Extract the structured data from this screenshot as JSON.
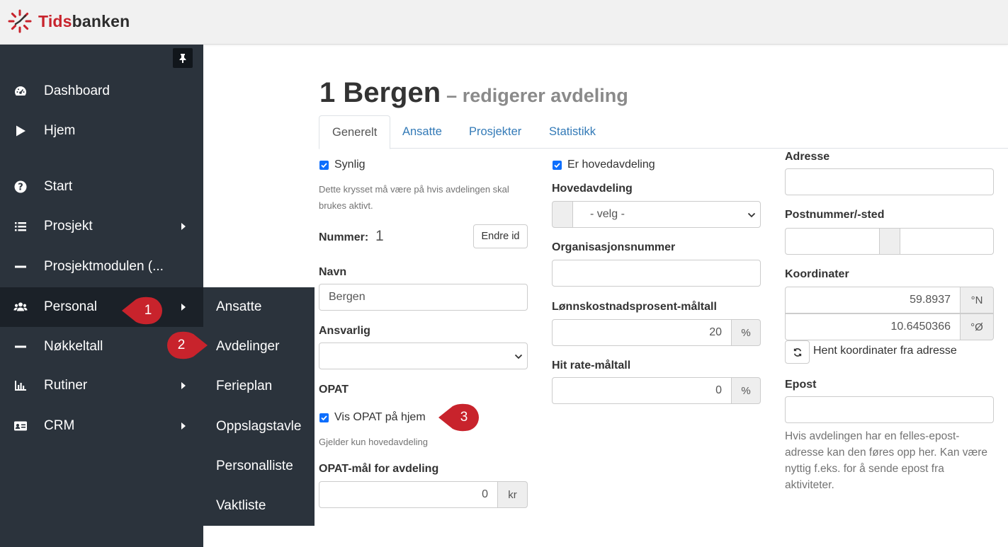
{
  "app": {
    "logo_prefix": "Tids",
    "logo_suffix": "banken"
  },
  "sidebar": {
    "items": [
      {
        "label": "Dashboard",
        "icon": "dashboard-icon"
      },
      {
        "label": "Hjem",
        "icon": "play-icon"
      },
      {
        "label": "Start",
        "icon": "question-circle-icon"
      },
      {
        "label": "Prosjekt",
        "icon": "list-icon"
      },
      {
        "label": "Prosjektmodulen (...",
        "icon": "minus-icon"
      },
      {
        "label": "Personal",
        "icon": "users-icon"
      },
      {
        "label": "Nøkkeltall",
        "icon": "minus-icon"
      },
      {
        "label": "Rutiner",
        "icon": "bar-chart-icon"
      },
      {
        "label": "CRM",
        "icon": "id-card-icon"
      }
    ],
    "submenu": [
      "Ansatte",
      "Avdelinger",
      "Ferieplan",
      "Oppslagstavle",
      "Personalliste",
      "Vaktliste"
    ]
  },
  "callouts": [
    "1",
    "2",
    "3"
  ],
  "page": {
    "title": "1 Bergen",
    "subtitle": "– redigerer avdeling"
  },
  "tabs": [
    "Generelt",
    "Ansatte",
    "Prosjekter",
    "Statistikk"
  ],
  "form": {
    "synlig_label": "Synlig",
    "synlig_help": "Dette krysset må være på hvis avdelingen skal brukes aktivt.",
    "nummer_label": "Nummer:",
    "nummer_value": "1",
    "endre_id_button": "Endre id",
    "navn_label": "Navn",
    "navn_value": "Bergen",
    "ansvarlig_label": "Ansvarlig",
    "opat_heading": "OPAT",
    "vis_opat_label": "Vis OPAT på hjem",
    "vis_opat_help": "Gjelder kun hovedavdeling",
    "opat_maal_label": "OPAT-mål for avdeling",
    "opat_maal_value": "0",
    "opat_maal_unit": "kr",
    "er_hovedavdeling_label": "Er hovedavdeling",
    "hovedavdeling_label": "Hovedavdeling",
    "hovedavdeling_value": "- velg -",
    "orgnr_label": "Organisasjonsnummer",
    "lonn_label": "Lønnskostnadsprosent-måltall",
    "lonn_value": "20",
    "lonn_unit": "%",
    "hitrate_label": "Hit rate-måltall",
    "hitrate_value": "0",
    "hitrate_unit": "%",
    "adresse_label": "Adresse",
    "postnr_label": "Postnummer/-sted",
    "koordinater_label": "Koordinater",
    "lat_value": "59.8937",
    "lat_unit": "°N",
    "lon_value": "10.6450366",
    "lon_unit": "°Ø",
    "hent_koord_label": "Hent koordinater fra adresse",
    "epost_label": "Epost",
    "epost_help": "Hvis avdelingen har en felles-epost-adresse kan den føres opp her. Kan være nyttig f.eks. for å sende epost fra aktiviteter."
  },
  "colors": {
    "sidebar": "#2b333c",
    "sidebar_active": "#1b2128",
    "link": "#337ab7",
    "callout": "#c8232c",
    "checkbox": "#0d6efd"
  }
}
